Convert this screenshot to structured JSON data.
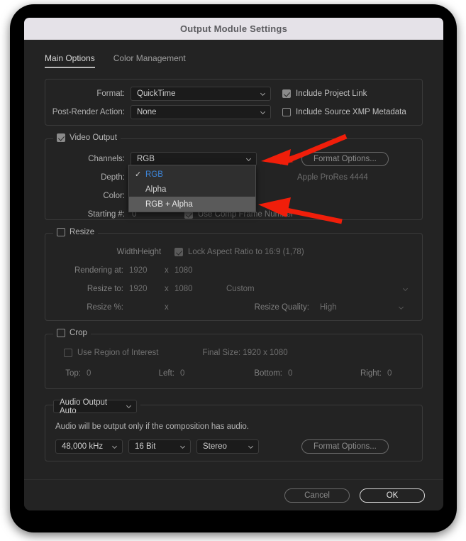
{
  "window": {
    "title": "Output Module Settings"
  },
  "tabs": [
    {
      "label": "Main Options",
      "active": true
    },
    {
      "label": "Color Management",
      "active": false
    }
  ],
  "format_section": {
    "format_label": "Format:",
    "format_value": "QuickTime",
    "post_render_label": "Post-Render Action:",
    "post_render_value": "None",
    "include_project_link": "Include Project Link",
    "include_xmp": "Include Source XMP Metadata"
  },
  "video_output": {
    "legend": "Video Output",
    "channels_label": "Channels:",
    "channels_value": "RGB",
    "depth_label": "Depth:",
    "color_label": "Color:",
    "starting_label": "Starting #:",
    "starting_value": "0",
    "use_comp_frame_number": "Use Comp Frame Number",
    "format_options_button": "Format Options...",
    "codec_text": "Apple ProRes 4444",
    "dropdown": {
      "open": true,
      "items": [
        {
          "label": "RGB",
          "checked": true,
          "hovered": false
        },
        {
          "label": "Alpha",
          "checked": false,
          "hovered": false
        },
        {
          "label": "RGB + Alpha",
          "checked": false,
          "hovered": true
        }
      ]
    }
  },
  "resize": {
    "legend": "Resize",
    "width_header": "Width",
    "height_header": "Height",
    "lock_aspect": "Lock Aspect Ratio to 16:9 (1,78)",
    "rendering_at_label": "Rendering at:",
    "rendering_width": "1920",
    "rendering_x": "x",
    "rendering_height": "1080",
    "resize_to_label": "Resize to:",
    "resize_width": "1920",
    "resize_x": "x",
    "resize_height": "1080",
    "resize_preset": "Custom",
    "resize_pct_label": "Resize %:",
    "resize_pct_x": "x",
    "resize_quality_label": "Resize Quality:",
    "resize_quality_value": "High"
  },
  "crop": {
    "legend": "Crop",
    "use_region_of_interest": "Use Region of Interest",
    "final_size": "Final Size: 1920 x 1080",
    "top_label": "Top:",
    "top_value": "0",
    "left_label": "Left:",
    "left_value": "0",
    "bottom_label": "Bottom:",
    "bottom_value": "0",
    "right_label": "Right:",
    "right_value": "0"
  },
  "audio": {
    "legend": "Audio Output Auto",
    "note": "Audio will be output only if the composition has audio.",
    "sample_rate": "48,000 kHz",
    "bit_depth": "16 Bit",
    "channels": "Stereo",
    "format_options_button": "Format Options..."
  },
  "footer": {
    "cancel": "Cancel",
    "ok": "OK"
  },
  "annotations": {
    "arrow_color": "#f01e0a",
    "arrow_count": 2
  }
}
